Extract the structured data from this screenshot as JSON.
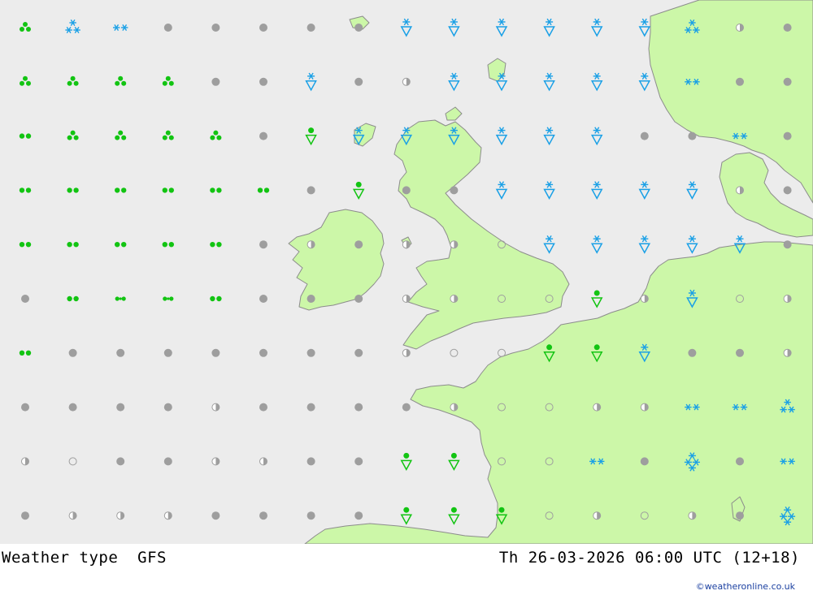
{
  "map": {
    "colors": {
      "sea": "#ececec",
      "land": "#ccf7a8",
      "coast": "#8c8c8c",
      "rain": "#12c412",
      "snow": "#1aa0e6",
      "cloud": "#9e9e9e"
    },
    "rows": [
      [
        "showers-heavy",
        "snow",
        "snow-light",
        "overcast",
        "overcast",
        "overcast",
        "overcast",
        "overcast",
        "snow-showers",
        "snow-showers",
        "snow-showers",
        "snow-showers",
        "snow-showers",
        "snow-showers",
        "snow",
        "partly-cloudy",
        "overcast"
      ],
      [
        "showers-heavy",
        "showers-heavy",
        "showers-heavy",
        "showers-heavy",
        "overcast",
        "overcast",
        "snow-showers",
        "overcast",
        "partly-cloudy",
        "snow-showers",
        "snow-showers",
        "snow-showers",
        "snow-showers",
        "snow-showers",
        "snow-light",
        "overcast",
        "overcast"
      ],
      [
        "rain-light",
        "showers-heavy",
        "showers-heavy",
        "showers-heavy",
        "showers-heavy",
        "overcast",
        "rain-showers",
        "snow-showers",
        "snow-showers",
        "snow-showers",
        "snow-showers",
        "snow-showers",
        "snow-showers",
        "overcast",
        "overcast",
        "snow-light",
        "overcast"
      ],
      [
        "rain-light",
        "rain-light",
        "rain-light",
        "rain-light",
        "rain-light",
        "rain-light",
        "overcast",
        "rain-showers",
        "overcast",
        "overcast",
        "snow-showers",
        "snow-showers",
        "snow-showers",
        "snow-showers",
        "snow-showers",
        "partly-cloudy",
        "overcast"
      ],
      [
        "rain-light",
        "rain-light",
        "rain-light",
        "rain-light",
        "rain-light",
        "overcast",
        "partly-cloudy",
        "overcast",
        "partly-cloudy",
        "partly-cloudy",
        "clear",
        "snow-showers",
        "snow-showers",
        "snow-showers",
        "snow-showers",
        "snow-showers",
        "overcast"
      ],
      [
        "overcast",
        "rain-light",
        "drizzle",
        "drizzle",
        "rain-light",
        "overcast",
        "overcast",
        "overcast",
        "partly-cloudy",
        "partly-cloudy",
        "clear",
        "clear",
        "rain-showers",
        "partly-cloudy",
        "snow-showers",
        "clear",
        "partly-cloudy"
      ],
      [
        "rain-light",
        "overcast",
        "overcast",
        "overcast",
        "overcast",
        "overcast",
        "overcast",
        "overcast",
        "partly-cloudy",
        "clear",
        "clear",
        "rain-showers",
        "rain-showers",
        "snow-showers",
        "overcast",
        "overcast",
        "partly-cloudy"
      ],
      [
        "overcast",
        "overcast",
        "overcast",
        "overcast",
        "partly-cloudy",
        "overcast",
        "overcast",
        "overcast",
        "overcast",
        "partly-cloudy",
        "clear",
        "clear",
        "partly-cloudy",
        "partly-cloudy",
        "snow-light",
        "snow-light",
        "snow"
      ],
      [
        "partly-cloudy",
        "clear",
        "overcast",
        "overcast",
        "partly-cloudy",
        "partly-cloudy",
        "overcast",
        "overcast",
        "rain-showers",
        "rain-showers",
        "clear",
        "clear",
        "snow-light",
        "overcast",
        "snow-heavy",
        "overcast",
        "snow-light"
      ],
      [
        "overcast",
        "partly-cloudy",
        "partly-cloudy",
        "partly-cloudy",
        "overcast",
        "overcast",
        "overcast",
        "overcast",
        "rain-showers",
        "rain-showers",
        "rain-showers",
        "clear",
        "partly-cloudy",
        "clear",
        "partly-cloudy",
        "overcast",
        "snow-heavy"
      ]
    ]
  },
  "footer": {
    "title": "Weather type  GFS",
    "datetime": "Th 26-03-2026 06:00 UTC (12+18)",
    "credit": "©weatheronline.co.uk"
  }
}
